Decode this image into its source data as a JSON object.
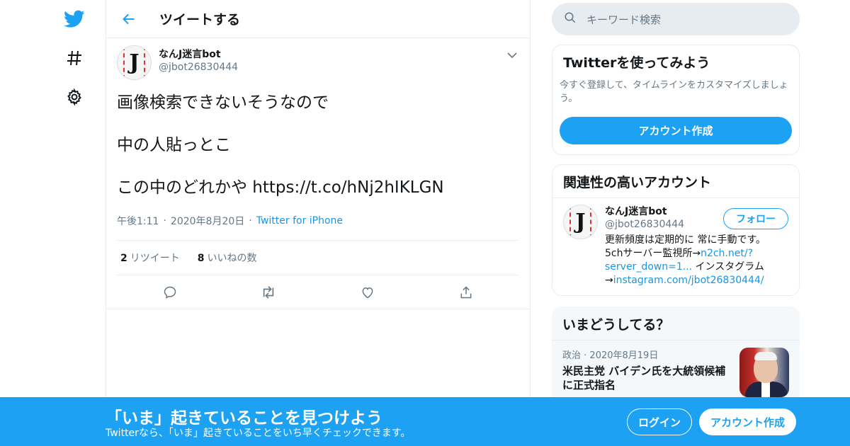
{
  "nav": {
    "icons": [
      "twitter-logo-icon",
      "hashtag-icon",
      "gear-icon"
    ]
  },
  "header": {
    "title": "ツイートする"
  },
  "tweet": {
    "display_name": "なんJ迷言bot",
    "handle": "@jbot26830444",
    "avatar_letter": "J",
    "body": "画像検索できないそうなので\n\n中の人貼っとこ\n\nこの中のどれかや https://t.co/hNj2hIKLGN",
    "time": "午後1:11",
    "date": "2020年8月20日",
    "source": "Twitter for iPhone",
    "retweet_count": "2",
    "retweet_label": "リツイート",
    "like_count": "8",
    "like_label": "いいねの数"
  },
  "search": {
    "placeholder": "キーワード検索"
  },
  "signup_card": {
    "title": "Twitterを使ってみよう",
    "desc": "今すぐ登録して、タイムラインをカスタマイズしましょう。",
    "button": "アカウント作成"
  },
  "related": {
    "title": "関連性の高いアカウント",
    "display_name": "なんJ迷言bot",
    "handle": "@jbot26830444",
    "follow": "フォロー",
    "bio_1": "更新頻度は定期的に 常に手動です。",
    "bio_2": "5chサーバー監視所→",
    "bio_link1": "n2ch.net/?server_down=1...",
    "bio_3": " インスタグラム→",
    "bio_link2": "instagram.com/jbot26830444/"
  },
  "trends": {
    "title": "いまどうしてる？",
    "category": "政治",
    "date": "2020年8月19日",
    "headline": "米民主党 バイデン氏を大統領候補に正式指名"
  },
  "banner": {
    "title": "「いま」起きていることを見つけよう",
    "subtitle": "Twitterなら、「いま」起きていることをいち早くチェックできます。",
    "login": "ログイン",
    "signup": "アカウント作成"
  },
  "colors": {
    "accent": "#1da1f2",
    "link": "#1b95e0",
    "muted": "#657786",
    "border": "#e6ecf0"
  }
}
